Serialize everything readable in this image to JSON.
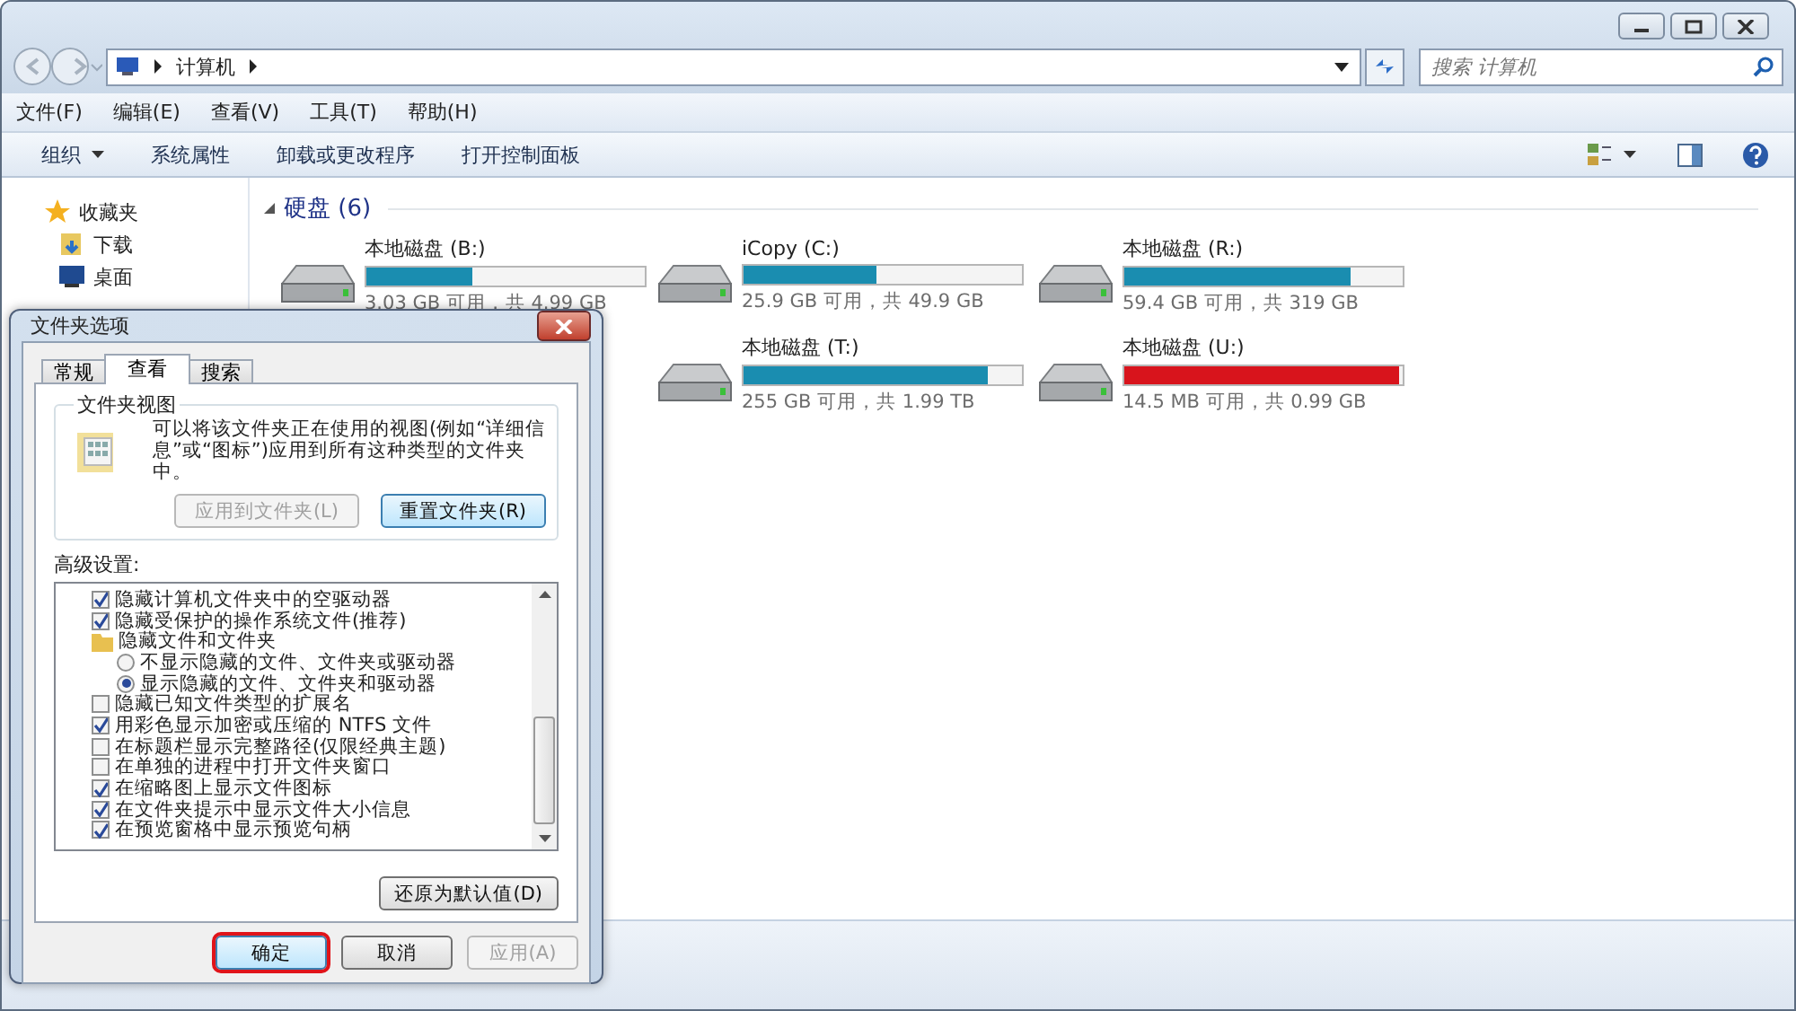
{
  "explorer": {
    "breadcrumb": [
      "计算机"
    ],
    "search": {
      "placeholder": "搜索 计算机"
    },
    "menu": [
      "文件(F)",
      "编辑(E)",
      "查看(V)",
      "工具(T)",
      "帮助(H)"
    ],
    "toolbar": [
      "组织",
      "系统属性",
      "卸载或更改程序",
      "打开控制面板"
    ],
    "sidebar": {
      "items": [
        {
          "label": "收藏夹",
          "kind": "star"
        },
        {
          "label": "下载",
          "kind": "download"
        },
        {
          "label": "桌面",
          "kind": "desktop"
        }
      ]
    },
    "group": {
      "title": "硬盘 (6)"
    },
    "drives": [
      {
        "name": "本地磁盘 (B:)",
        "level": 0.38,
        "color": "#1a8db0",
        "info": "3.03 GB 可用，共 4.99 GB"
      },
      {
        "name": "iCopy (C:)",
        "level": 0.48,
        "color": "#1a8db0",
        "info": "25.9 GB 可用，共 49.9 GB"
      },
      {
        "name": "本地磁盘 (R:)",
        "level": 0.81,
        "color": "#1a8db0",
        "info": "59.4 GB 可用，共 319 GB"
      },
      {
        "name": "本地磁盘 (T:)",
        "level": 0.88,
        "color": "#1a8db0",
        "info": "255 GB 可用，共 1.99 TB"
      },
      {
        "name": "本地磁盘 (U:)",
        "level": 0.99,
        "color": "#d8141c",
        "info": "14.5 MB 可用，共 0.99 GB"
      }
    ]
  },
  "dialog": {
    "title": "文件夹选项",
    "tabs": [
      {
        "label": "常规",
        "selected": false
      },
      {
        "label": "查看",
        "selected": true
      },
      {
        "label": "搜索",
        "selected": false
      }
    ],
    "folder_views": {
      "title": "文件夹视图",
      "text": "可以将该文件夹正在使用的视图(例如“详细信息”或“图标”)应用到所有这种类型的文件夹中。",
      "buttons": [
        {
          "label": "应用到文件夹(L)",
          "disabled": true
        },
        {
          "label": "重置文件夹(R)",
          "disabled": false
        }
      ]
    },
    "advanced": {
      "title": "高级设置:",
      "items": [
        {
          "kind": "checkbox",
          "label": "隐藏计算机文件夹中的空驱动器",
          "checked": true
        },
        {
          "kind": "checkbox",
          "label": "隐藏受保护的操作系统文件(推荐)",
          "checked": true
        },
        {
          "kind": "folder",
          "label": "隐藏文件和文件夹"
        },
        {
          "kind": "radio",
          "label": "不显示隐藏的文件、文件夹或驱动器",
          "selected": false
        },
        {
          "kind": "radio",
          "label": "显示隐藏的文件、文件夹和驱动器",
          "selected": true
        },
        {
          "kind": "checkbox",
          "label": "隐藏已知文件类型的扩展名",
          "checked": false
        },
        {
          "kind": "checkbox",
          "label": "用彩色显示加密或压缩的 NTFS 文件",
          "checked": true
        },
        {
          "kind": "checkbox",
          "label": "在标题栏显示完整路径(仅限经典主题)",
          "checked": false
        },
        {
          "kind": "checkbox",
          "label": "在单独的进程中打开文件夹窗口",
          "checked": false
        },
        {
          "kind": "checkbox",
          "label": "在缩略图上显示文件图标",
          "checked": true
        },
        {
          "kind": "checkbox",
          "label": "在文件夹提示中显示文件大小信息",
          "checked": true
        },
        {
          "kind": "checkbox",
          "label": "在预览窗格中显示预览句柄",
          "checked": true
        }
      ],
      "restore": "还原为默认值(D)"
    },
    "buttons": [
      {
        "label": "确定",
        "disabled": false,
        "highlighted": true
      },
      {
        "label": "取消",
        "disabled": false,
        "highlighted": false
      },
      {
        "label": "应用(A)",
        "disabled": true,
        "highlighted": false
      }
    ]
  }
}
